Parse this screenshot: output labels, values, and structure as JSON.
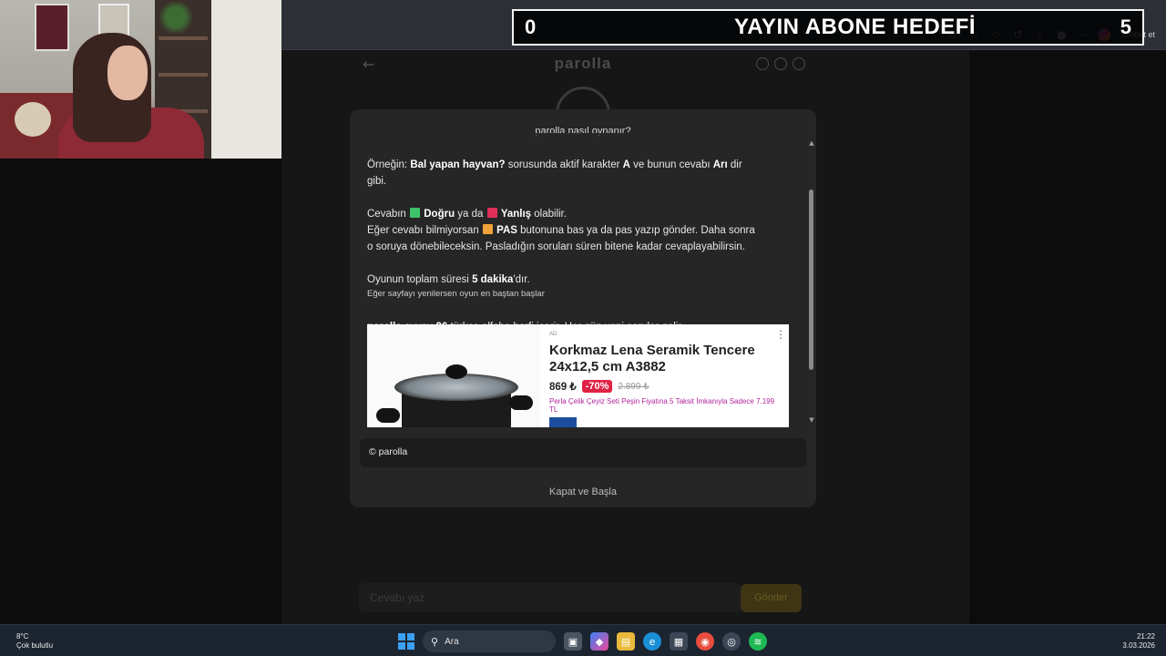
{
  "stream_goal": {
    "start": "0",
    "title": "YAYIN ABONE HEDEFİ",
    "end": "5"
  },
  "browser": {
    "chat_label": "Sohbet et"
  },
  "page": {
    "brand": "parolla",
    "answer_placeholder": "Cevabı yaz",
    "send_label": "Gönder"
  },
  "modal": {
    "title": "parolla nasıl oynanır?",
    "line_example_prefix": "Örneğin: ",
    "line_example_bold": "Bal yapan hayvan?",
    "line_example_mid": " sorusunda aktif karakter ",
    "line_example_letter": "A",
    "line_example_mid2": " ve bunun cevabı ",
    "line_example_answer": "Arı",
    "line_example_suffix": " dir",
    "line_example_cont": "gibi.",
    "answer_prefix": "Cevabın ",
    "correct": "Doğru",
    "or": " ya da ",
    "wrong": "Yanlış",
    "answer_suffix": " olabilir.",
    "pass_prefix": "Eğer cevabı bilmiyorsan ",
    "pass": "PAS",
    "pass_suffix": " butonuna bas ya da pas yazıp gönder. Daha sonra",
    "pass_cont": "o soruya dönebileceksin. Pasladığın soruları süren bitene kadar cevaplayabilirsin.",
    "time_prefix": "Oyunun toplam süresi ",
    "time_bold": "5 dakika",
    "time_suffix": "'dır.",
    "refresh_note": "Eğer sayfayı yenilersen oyun en baştan başlar",
    "letters_brand": "parolla",
    "letters_mid": " oyunu ",
    "letters_count": "26",
    "letters_suffix": " türkçe alfabe harfi içerir. Her gün yeni sorular gelir.",
    "copyright": "© parolla",
    "close_button": "Kapat ve Başla"
  },
  "ad": {
    "tag": "AD",
    "title": "Korkmaz Lena Seramik Tencere 24x12,5 cm A3882",
    "price": "869 ₺",
    "discount": "-70%",
    "old_price": "2.899 ₺",
    "description": "Perla Çelik Çeyiz Seti Peşin Fiyatına 5 Taksit İmkanıyla Sadece 7.199 TL"
  },
  "taskbar": {
    "weather_temp": "8°C",
    "weather_desc": "Çok bulutlu",
    "search_placeholder": "Ara",
    "time": "21:22",
    "date": "3.03.2026"
  },
  "colors": {
    "correct_square": "#3cc36a",
    "wrong_square": "#e0305a",
    "pass_square": "#f0a33a",
    "ad_discount": "#e02246"
  }
}
